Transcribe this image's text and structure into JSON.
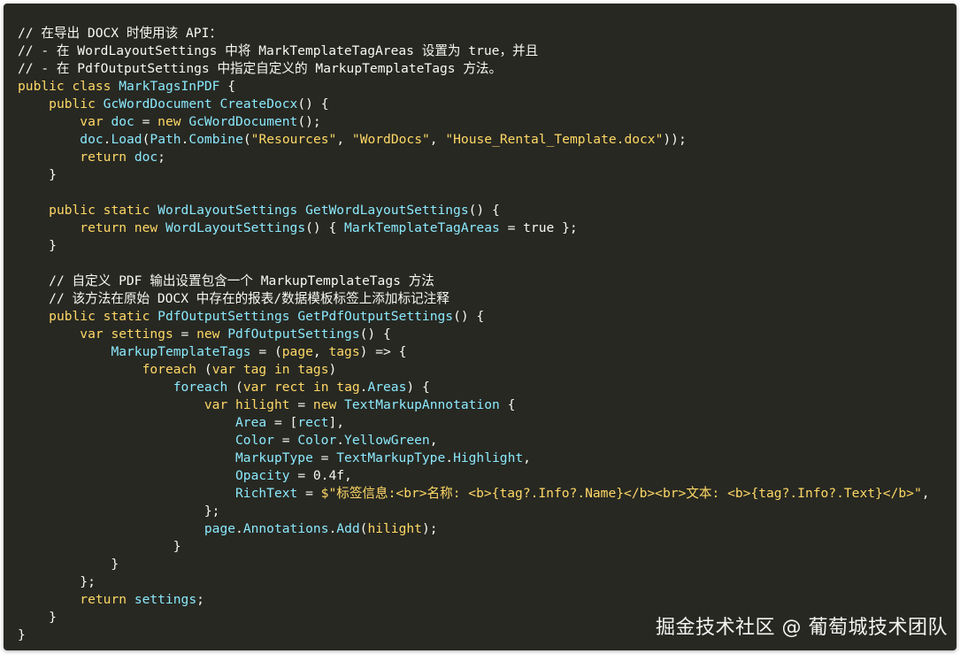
{
  "theme": {
    "background": "#272822",
    "text": "#f8f8f2",
    "keyword": "#ffd866",
    "type": "#8be9fd",
    "string": "#ffd866",
    "comment": "#f8f8f2"
  },
  "watermark": "掘金技术社区 @ 葡萄城技术团队",
  "code_lines": [
    [
      {
        "t": "comment",
        "v": "// 在导出 DOCX 时使用该 API："
      }
    ],
    [
      {
        "t": "comment",
        "v": "// - 在 WordLayoutSettings 中将 MarkTemplateTagAreas 设置为 true，并且"
      }
    ],
    [
      {
        "t": "comment",
        "v": "// - 在 PdfOutputSettings 中指定自定义的 MarkupTemplateTags 方法。"
      }
    ],
    [
      {
        "t": "kw",
        "v": "public class "
      },
      {
        "t": "type",
        "v": "MarkTagsInPDF"
      },
      {
        "t": "plain",
        "v": " {"
      }
    ],
    [
      {
        "t": "plain",
        "v": "    "
      },
      {
        "t": "kw",
        "v": "public "
      },
      {
        "t": "type",
        "v": "GcWordDocument"
      },
      {
        "t": "plain",
        "v": " "
      },
      {
        "t": "type",
        "v": "CreateDocx"
      },
      {
        "t": "plain",
        "v": "() {"
      }
    ],
    [
      {
        "t": "plain",
        "v": "        "
      },
      {
        "t": "kw",
        "v": "var "
      },
      {
        "t": "type",
        "v": "doc"
      },
      {
        "t": "plain",
        "v": " = "
      },
      {
        "t": "kw",
        "v": "new "
      },
      {
        "t": "type",
        "v": "GcWordDocument"
      },
      {
        "t": "plain",
        "v": "();"
      }
    ],
    [
      {
        "t": "plain",
        "v": "        "
      },
      {
        "t": "type",
        "v": "doc"
      },
      {
        "t": "plain",
        "v": "."
      },
      {
        "t": "type",
        "v": "Load"
      },
      {
        "t": "plain",
        "v": "("
      },
      {
        "t": "type",
        "v": "Path"
      },
      {
        "t": "plain",
        "v": "."
      },
      {
        "t": "type",
        "v": "Combine"
      },
      {
        "t": "plain",
        "v": "("
      },
      {
        "t": "str",
        "v": "\"Resources\""
      },
      {
        "t": "plain",
        "v": ", "
      },
      {
        "t": "str",
        "v": "\"WordDocs\""
      },
      {
        "t": "plain",
        "v": ", "
      },
      {
        "t": "str",
        "v": "\"House_Rental_Template.docx\""
      },
      {
        "t": "plain",
        "v": "));"
      }
    ],
    [
      {
        "t": "plain",
        "v": "        "
      },
      {
        "t": "kw",
        "v": "return "
      },
      {
        "t": "type",
        "v": "doc"
      },
      {
        "t": "plain",
        "v": ";"
      }
    ],
    [
      {
        "t": "plain",
        "v": "    }"
      }
    ],
    [
      {
        "t": "plain",
        "v": ""
      }
    ],
    [
      {
        "t": "plain",
        "v": "    "
      },
      {
        "t": "kw",
        "v": "public static "
      },
      {
        "t": "type",
        "v": "WordLayoutSettings"
      },
      {
        "t": "plain",
        "v": " "
      },
      {
        "t": "type",
        "v": "GetWordLayoutSettings"
      },
      {
        "t": "plain",
        "v": "() {"
      }
    ],
    [
      {
        "t": "plain",
        "v": "        "
      },
      {
        "t": "kw",
        "v": "return new "
      },
      {
        "t": "type",
        "v": "WordLayoutSettings"
      },
      {
        "t": "plain",
        "v": "() { "
      },
      {
        "t": "type",
        "v": "MarkTemplateTagAreas"
      },
      {
        "t": "plain",
        "v": " = "
      },
      {
        "t": "num",
        "v": "true"
      },
      {
        "t": "plain",
        "v": " };"
      }
    ],
    [
      {
        "t": "plain",
        "v": "    }"
      }
    ],
    [
      {
        "t": "plain",
        "v": ""
      }
    ],
    [
      {
        "t": "plain",
        "v": "    "
      },
      {
        "t": "comment",
        "v": "// 自定义 PDF 输出设置包含一个 MarkupTemplateTags 方法"
      }
    ],
    [
      {
        "t": "plain",
        "v": "    "
      },
      {
        "t": "comment",
        "v": "// 该方法在原始 DOCX 中存在的报表/数据模板标签上添加标记注释"
      }
    ],
    [
      {
        "t": "plain",
        "v": "    "
      },
      {
        "t": "kw",
        "v": "public static "
      },
      {
        "t": "type",
        "v": "PdfOutputSettings"
      },
      {
        "t": "plain",
        "v": " "
      },
      {
        "t": "type",
        "v": "GetPdfOutputSettings"
      },
      {
        "t": "plain",
        "v": "() {"
      }
    ],
    [
      {
        "t": "plain",
        "v": "        "
      },
      {
        "t": "kw",
        "v": "var "
      },
      {
        "t": "kw",
        "v": "settings"
      },
      {
        "t": "plain",
        "v": " = "
      },
      {
        "t": "kw",
        "v": "new "
      },
      {
        "t": "type",
        "v": "PdfOutputSettings"
      },
      {
        "t": "plain",
        "v": "() {"
      }
    ],
    [
      {
        "t": "plain",
        "v": "            "
      },
      {
        "t": "type",
        "v": "MarkupTemplateTags"
      },
      {
        "t": "plain",
        "v": " = ("
      },
      {
        "t": "kw",
        "v": "page"
      },
      {
        "t": "plain",
        "v": ", "
      },
      {
        "t": "kw",
        "v": "tags"
      },
      {
        "t": "plain",
        "v": ") => {"
      }
    ],
    [
      {
        "t": "plain",
        "v": "                "
      },
      {
        "t": "kw",
        "v": "foreach"
      },
      {
        "t": "plain",
        "v": " ("
      },
      {
        "t": "kw",
        "v": "var "
      },
      {
        "t": "kw",
        "v": "tag"
      },
      {
        "t": "plain",
        "v": " "
      },
      {
        "t": "kw",
        "v": "in "
      },
      {
        "t": "kw",
        "v": "tags"
      },
      {
        "t": "plain",
        "v": ")"
      }
    ],
    [
      {
        "t": "plain",
        "v": "                    "
      },
      {
        "t": "type",
        "v": "foreach"
      },
      {
        "t": "plain",
        "v": " ("
      },
      {
        "t": "kw",
        "v": "var "
      },
      {
        "t": "kw",
        "v": "rect"
      },
      {
        "t": "plain",
        "v": " "
      },
      {
        "t": "kw",
        "v": "in "
      },
      {
        "t": "kw",
        "v": "tag"
      },
      {
        "t": "plain",
        "v": "."
      },
      {
        "t": "type",
        "v": "Areas"
      },
      {
        "t": "plain",
        "v": ") {"
      }
    ],
    [
      {
        "t": "plain",
        "v": "                        "
      },
      {
        "t": "kw",
        "v": "var "
      },
      {
        "t": "kw",
        "v": "hilight"
      },
      {
        "t": "plain",
        "v": " = "
      },
      {
        "t": "kw",
        "v": "new "
      },
      {
        "t": "type",
        "v": "TextMarkupAnnotation"
      },
      {
        "t": "plain",
        "v": " {"
      }
    ],
    [
      {
        "t": "plain",
        "v": "                            "
      },
      {
        "t": "type",
        "v": "Area"
      },
      {
        "t": "plain",
        "v": " = ["
      },
      {
        "t": "type",
        "v": "rect"
      },
      {
        "t": "plain",
        "v": "],"
      }
    ],
    [
      {
        "t": "plain",
        "v": "                            "
      },
      {
        "t": "type",
        "v": "Color"
      },
      {
        "t": "plain",
        "v": " = "
      },
      {
        "t": "type",
        "v": "Color"
      },
      {
        "t": "plain",
        "v": "."
      },
      {
        "t": "type",
        "v": "YellowGreen"
      },
      {
        "t": "plain",
        "v": ","
      }
    ],
    [
      {
        "t": "plain",
        "v": "                            "
      },
      {
        "t": "type",
        "v": "MarkupType"
      },
      {
        "t": "plain",
        "v": " = "
      },
      {
        "t": "type",
        "v": "TextMarkupType"
      },
      {
        "t": "plain",
        "v": "."
      },
      {
        "t": "type",
        "v": "Highlight"
      },
      {
        "t": "plain",
        "v": ","
      }
    ],
    [
      {
        "t": "plain",
        "v": "                            "
      },
      {
        "t": "type",
        "v": "Opacity"
      },
      {
        "t": "plain",
        "v": " = 0.4f,"
      }
    ],
    [
      {
        "t": "plain",
        "v": "                            "
      },
      {
        "t": "type",
        "v": "RichText"
      },
      {
        "t": "plain",
        "v": " = "
      },
      {
        "t": "str",
        "v": "$\"标签信息:<br>名称: <b>{tag?.Info?.Name}</b><br>文本: <b>{tag?.Info?.Text}</b>\""
      },
      {
        "t": "plain",
        "v": ","
      }
    ],
    [
      {
        "t": "plain",
        "v": "                        };"
      }
    ],
    [
      {
        "t": "plain",
        "v": "                        "
      },
      {
        "t": "type",
        "v": "page"
      },
      {
        "t": "plain",
        "v": "."
      },
      {
        "t": "type",
        "v": "Annotations"
      },
      {
        "t": "plain",
        "v": "."
      },
      {
        "t": "type",
        "v": "Add"
      },
      {
        "t": "plain",
        "v": "("
      },
      {
        "t": "kw",
        "v": "hilight"
      },
      {
        "t": "plain",
        "v": ");"
      }
    ],
    [
      {
        "t": "plain",
        "v": "                    }"
      }
    ],
    [
      {
        "t": "plain",
        "v": "            }"
      }
    ],
    [
      {
        "t": "plain",
        "v": "        };"
      }
    ],
    [
      {
        "t": "plain",
        "v": "        "
      },
      {
        "t": "kw",
        "v": "return "
      },
      {
        "t": "type",
        "v": "settings"
      },
      {
        "t": "plain",
        "v": ";"
      }
    ],
    [
      {
        "t": "plain",
        "v": "    }"
      }
    ],
    [
      {
        "t": "plain",
        "v": "}"
      }
    ]
  ]
}
